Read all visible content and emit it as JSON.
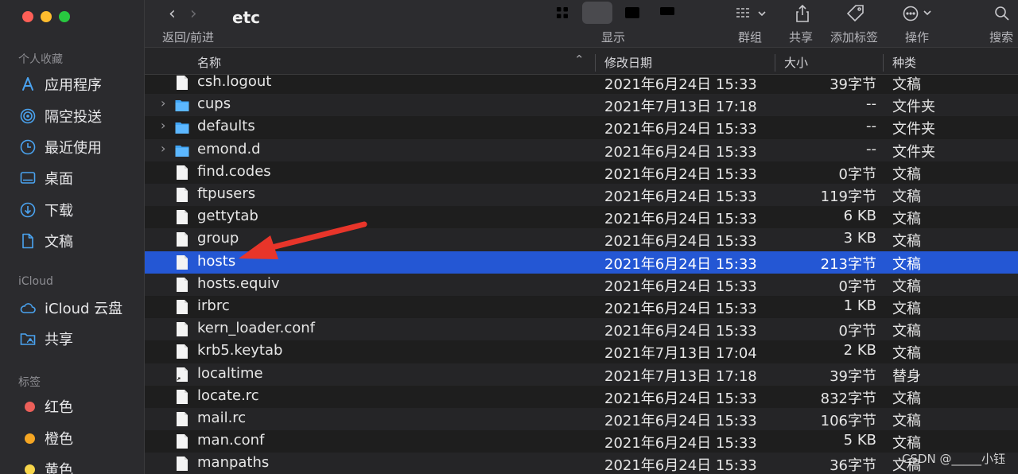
{
  "window": {
    "title": "etc"
  },
  "toolbar": {
    "back_forward_label": "返回/前进",
    "view_label": "显示",
    "group_label": "群组",
    "share_label": "共享",
    "add_tag_label": "添加标签",
    "action_label": "操作",
    "search_label": "搜索"
  },
  "sidebar": {
    "favorites_title": "个人收藏",
    "favorites": [
      {
        "label": "应用程序",
        "icon": "applications-icon"
      },
      {
        "label": "隔空投送",
        "icon": "airdrop-icon"
      },
      {
        "label": "最近使用",
        "icon": "recents-icon"
      },
      {
        "label": "桌面",
        "icon": "desktop-icon"
      },
      {
        "label": "下载",
        "icon": "downloads-icon"
      },
      {
        "label": "文稿",
        "icon": "documents-icon"
      }
    ],
    "icloud_title": "iCloud",
    "icloud": [
      {
        "label": "iCloud 云盘",
        "icon": "cloud-icon"
      },
      {
        "label": "共享",
        "icon": "shared-folder-icon"
      }
    ],
    "tags_title": "标签",
    "tags": [
      {
        "label": "红色",
        "color": "#ec5f59"
      },
      {
        "label": "橙色",
        "color": "#f5a623"
      },
      {
        "label": "黄色",
        "color": "#f7d54a"
      }
    ]
  },
  "columns": {
    "name": "名称",
    "modified": "修改日期",
    "size": "大小",
    "kind": "种类"
  },
  "files": [
    {
      "name": "csh.logout",
      "date": "2021年6月24日 15:33",
      "size": "39字节",
      "kind": "文稿",
      "folder": false
    },
    {
      "name": "cups",
      "date": "2021年7月13日 17:18",
      "size": "--",
      "kind": "文件夹",
      "folder": true
    },
    {
      "name": "defaults",
      "date": "2021年6月24日 15:33",
      "size": "--",
      "kind": "文件夹",
      "folder": true
    },
    {
      "name": "emond.d",
      "date": "2021年6月24日 15:33",
      "size": "--",
      "kind": "文件夹",
      "folder": true
    },
    {
      "name": "find.codes",
      "date": "2021年6月24日 15:33",
      "size": "0字节",
      "kind": "文稿",
      "folder": false
    },
    {
      "name": "ftpusers",
      "date": "2021年6月24日 15:33",
      "size": "119字节",
      "kind": "文稿",
      "folder": false
    },
    {
      "name": "gettytab",
      "date": "2021年6月24日 15:33",
      "size": "6 KB",
      "kind": "文稿",
      "folder": false
    },
    {
      "name": "group",
      "date": "2021年6月24日 15:33",
      "size": "3 KB",
      "kind": "文稿",
      "folder": false
    },
    {
      "name": "hosts",
      "date": "2021年6月24日 15:33",
      "size": "213字节",
      "kind": "文稿",
      "folder": false,
      "selected": true
    },
    {
      "name": "hosts.equiv",
      "date": "2021年6月24日 15:33",
      "size": "0字节",
      "kind": "文稿",
      "folder": false
    },
    {
      "name": "irbrc",
      "date": "2021年6月24日 15:33",
      "size": "1 KB",
      "kind": "文稿",
      "folder": false
    },
    {
      "name": "kern_loader.conf",
      "date": "2021年6月24日 15:33",
      "size": "0字节",
      "kind": "文稿",
      "folder": false
    },
    {
      "name": "krb5.keytab",
      "date": "2021年7月13日 17:04",
      "size": "2 KB",
      "kind": "文稿",
      "folder": false
    },
    {
      "name": "localtime",
      "date": "2021年7月13日 17:18",
      "size": "39字节",
      "kind": "替身",
      "folder": false,
      "alias": true
    },
    {
      "name": "locate.rc",
      "date": "2021年6月24日 15:33",
      "size": "832字节",
      "kind": "文稿",
      "folder": false
    },
    {
      "name": "mail.rc",
      "date": "2021年6月24日 15:33",
      "size": "106字节",
      "kind": "文稿",
      "folder": false
    },
    {
      "name": "man.conf",
      "date": "2021年6月24日 15:33",
      "size": "5 KB",
      "kind": "文稿",
      "folder": false
    },
    {
      "name": "manpaths",
      "date": "2021年6月24日 15:33",
      "size": "36字节",
      "kind": "文稿",
      "folder": false
    }
  ],
  "watermark": "CSDN @_____小钰",
  "colors": {
    "selection": "#2457d4",
    "folder": "#3fa4f5",
    "annotation_arrow": "#e8352a"
  }
}
